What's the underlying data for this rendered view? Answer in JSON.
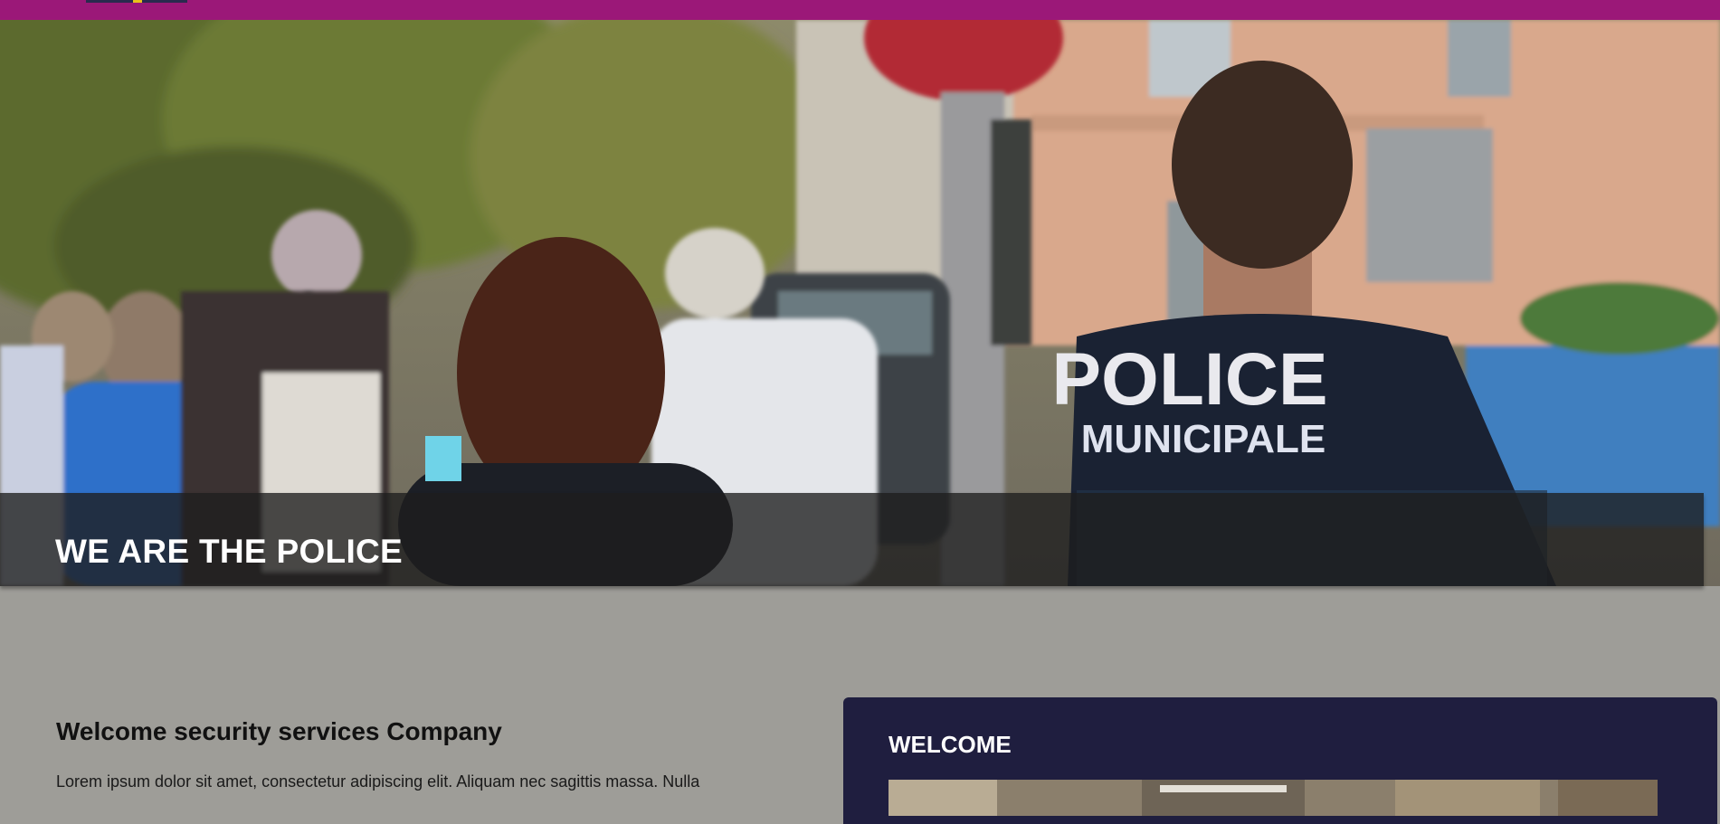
{
  "hero": {
    "title": "WE ARE THE POLICE",
    "shirt_line1": "POLICE",
    "shirt_line2": "MUNICIPALE"
  },
  "intro": {
    "heading": "Welcome security services Company",
    "body": "Lorem ipsum dolor sit amet, consectetur adipiscing elit. Aliquam nec sagittis massa. Nulla"
  },
  "welcome_card": {
    "heading": "WELCOME"
  },
  "colors": {
    "top_bar": "#9b1878",
    "caption_bg": "#1e1e1e",
    "card_bg": "#1f1e3f",
    "page_bg": "#9e9d98"
  }
}
